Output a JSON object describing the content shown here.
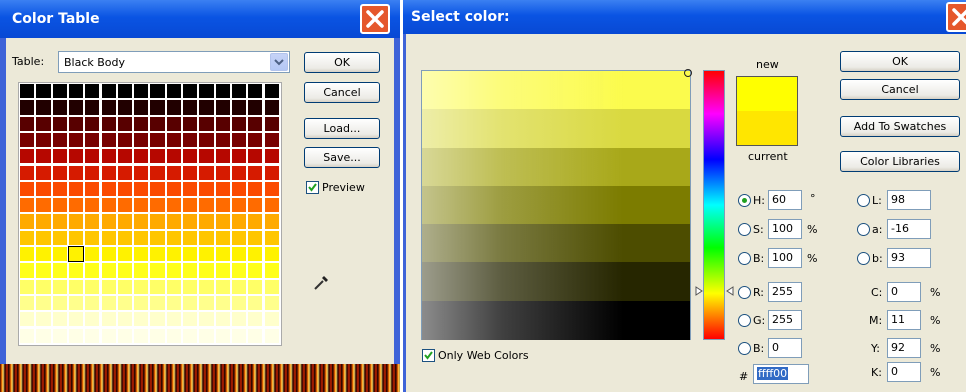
{
  "color_table": {
    "title": "Color Table",
    "table_label": "Table:",
    "table_value": "Black Body",
    "buttons": {
      "ok": "OK",
      "cancel": "Cancel",
      "load": "Load...",
      "save": "Save..."
    },
    "preview_label": "Preview",
    "preview_checked": true,
    "grid_colors": [
      "#000000",
      "#210000",
      "#3a0000",
      "#580000",
      "#780000",
      "#980000",
      "#b60700",
      "#d61b00",
      "#ef2f00",
      "#fb4a00",
      "#ff6b00",
      "#ff8b00",
      "#ffaa00",
      "#ffc600",
      "#ffe000",
      "#fff200",
      "#ffff1a",
      "#ffff40",
      "#ffff66",
      "#ffff8c",
      "#ffffb0",
      "#ffffcc",
      "#ffffe6"
    ]
  },
  "select_color": {
    "title": "Select color:",
    "new_label": "new",
    "current_label": "current",
    "new_color": "#ffff00",
    "current_color": "#ffe600",
    "buttons": {
      "ok": "OK",
      "cancel": "Cancel",
      "add_to_swatches": "Add To Swatches",
      "color_libraries": "Color Libraries"
    },
    "only_web_colors": "Only Web Colors",
    "hsb": [
      {
        "label": "H:",
        "value": "60",
        "unit": "°",
        "selected": true
      },
      {
        "label": "S:",
        "value": "100",
        "unit": "%",
        "selected": false
      },
      {
        "label": "B:",
        "value": "100",
        "unit": "%",
        "selected": false
      }
    ],
    "rgb": [
      {
        "label": "R:",
        "value": "255"
      },
      {
        "label": "G:",
        "value": "255"
      },
      {
        "label": "B:",
        "value": "0"
      }
    ],
    "lab": [
      {
        "label": "L:",
        "value": "98"
      },
      {
        "label": "a:",
        "value": "-16"
      },
      {
        "label": "b:",
        "value": "93"
      }
    ],
    "cmyk": [
      {
        "label": "C:",
        "value": "0",
        "unit": "%"
      },
      {
        "label": "M:",
        "value": "11",
        "unit": "%"
      },
      {
        "label": "Y:",
        "value": "92",
        "unit": "%"
      },
      {
        "label": "K:",
        "value": "0",
        "unit": "%"
      }
    ],
    "hex_label": "#",
    "hex_value": "ffff00",
    "field_bands": [
      "#fbfb4d",
      "#d9d940",
      "#a8a819",
      "#7c7c00",
      "#4d4d00",
      "#262600",
      "#000000"
    ]
  }
}
